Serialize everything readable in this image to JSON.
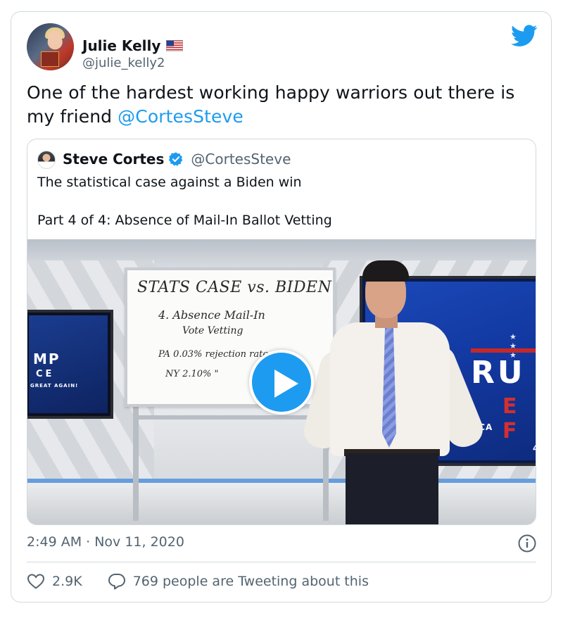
{
  "tweet": {
    "author_name": "Julie Kelly",
    "author_handle": "@julie_kelly2",
    "author_flag_icon": "us-flag-icon",
    "text_prefix": "One of the hardest working happy warriors out there is my friend ",
    "mention": "@CortesSteve",
    "timestamp": "2:49 AM · Nov 11, 2020",
    "likes": "2.9K",
    "replies_text": "769 people are Tweeting about this"
  },
  "quoted": {
    "author_name": "Steve Cortes",
    "author_handle": "@CortesSteve",
    "line1": "The statistical case against a Biden win",
    "line2": "Part 4 of 4: Absence of Mail-In Ballot Vetting"
  },
  "video": {
    "whiteboard": {
      "title": "STATS CASE vs. BIDEN",
      "line1": "4. Absence Mail-In",
      "line2": "Vote Vetting",
      "line3": "PA 0.03% rejection rate",
      "line4": "NY 2.10%    \""
    },
    "screen_left": {
      "t1": "MP",
      "t2": "CE",
      "t3": "GREAT AGAIN!"
    },
    "screen_right": {
      "stars": "★ ★ ★",
      "big": "RU",
      "red": "E F",
      "text": "MA    MERICA",
      "num": "4"
    }
  },
  "colors": {
    "accent": "#1d9bf0",
    "text_primary": "#0f1419",
    "text_secondary": "#536471",
    "border": "#cfd9de"
  }
}
